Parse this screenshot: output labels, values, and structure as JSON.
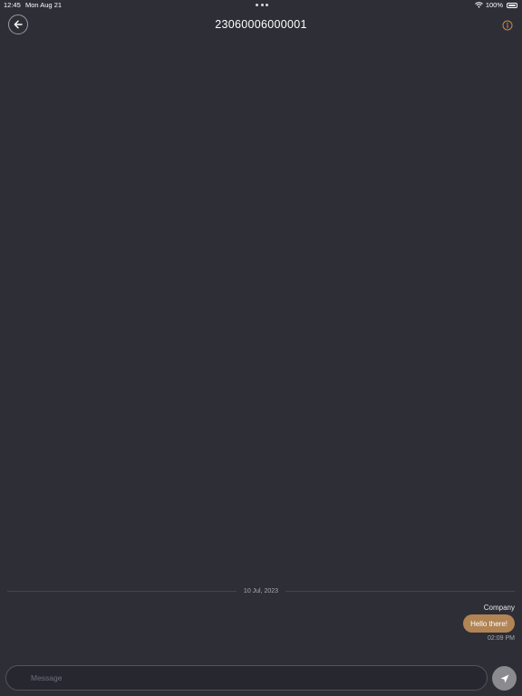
{
  "status_bar": {
    "time": "12:45",
    "date": "Mon Aug 21",
    "battery": "100%",
    "icons": [
      "wifi-icon",
      "battery-icon"
    ]
  },
  "header": {
    "title": "23060006000001",
    "back_icon": "arrow-left-icon",
    "info_icon": "info-icon"
  },
  "conversation": {
    "date_divider": "10 Jul, 2023",
    "messages": [
      {
        "sender": "Company",
        "text": "Hello there!",
        "time": "02:09 PM"
      }
    ]
  },
  "composer": {
    "placeholder": "Message",
    "value": "",
    "send_icon": "send-icon"
  },
  "colors": {
    "background": "#2e2e36",
    "accent": "#c38b4d",
    "bubble": "#b08454",
    "send_button": "#8a8a8f"
  }
}
